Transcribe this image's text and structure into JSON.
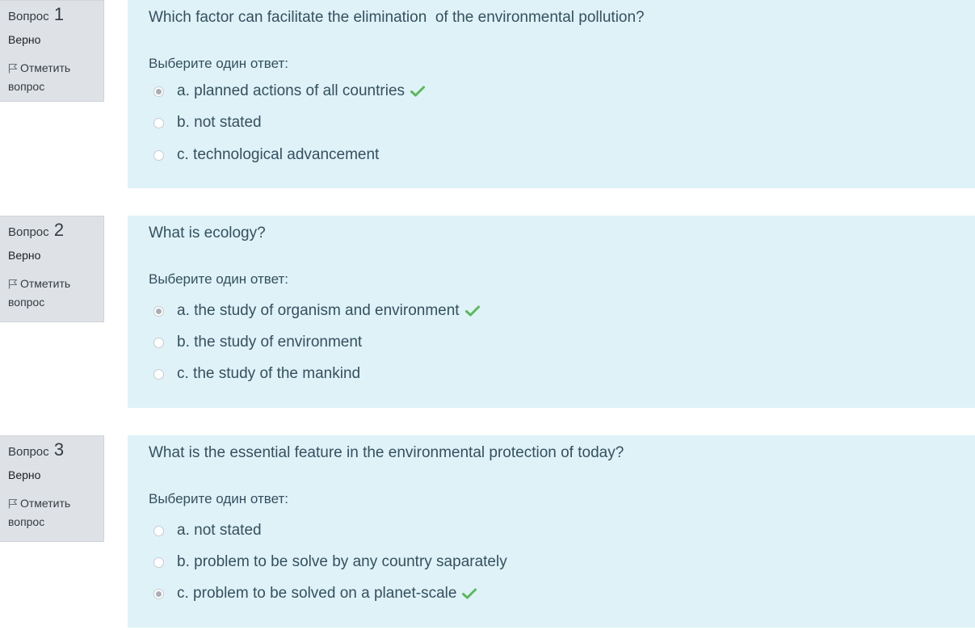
{
  "questions": [
    {
      "prefix": "Вопрос",
      "number": "1",
      "state": "Верно",
      "flag_label": "Отметить вопрос",
      "text": "Which factor can facilitate the elimination  of the environmental pollution?",
      "prompt": "Выберите один ответ:",
      "answers": [
        {
          "label": "a. planned actions of all countries",
          "selected": true,
          "correct": true
        },
        {
          "label": "b. not stated",
          "selected": false,
          "correct": false
        },
        {
          "label": "c. technological advancement",
          "selected": false,
          "correct": false
        }
      ]
    },
    {
      "prefix": "Вопрос",
      "number": "2",
      "state": "Верно",
      "flag_label": "Отметить вопрос",
      "text": "What is ecology?",
      "prompt": "Выберите один ответ:",
      "answers": [
        {
          "label": "a. the study of organism and environment",
          "selected": true,
          "correct": true
        },
        {
          "label": "b. the study of environment",
          "selected": false,
          "correct": false
        },
        {
          "label": "c. the study of the mankind",
          "selected": false,
          "correct": false
        }
      ]
    },
    {
      "prefix": "Вопрос",
      "number": "3",
      "state": "Верно",
      "flag_label": "Отметить вопрос",
      "text": "What is the essential feature in the environmental protection of today?",
      "prompt": "Выберите один ответ:",
      "answers": [
        {
          "label": "a. not stated",
          "selected": false,
          "correct": false
        },
        {
          "label": "b. problem to be solve by any country saparately",
          "selected": false,
          "correct": false
        },
        {
          "label": "c. problem to be solved on a planet-scale",
          "selected": true,
          "correct": true
        }
      ]
    }
  ],
  "icons": {
    "flag": "flag-icon",
    "correct": "check-icon"
  },
  "colors": {
    "info_background": "#dee2e6",
    "content_background": "#def2f8",
    "text": "#35505e",
    "correct_check": "#5cb85c"
  }
}
